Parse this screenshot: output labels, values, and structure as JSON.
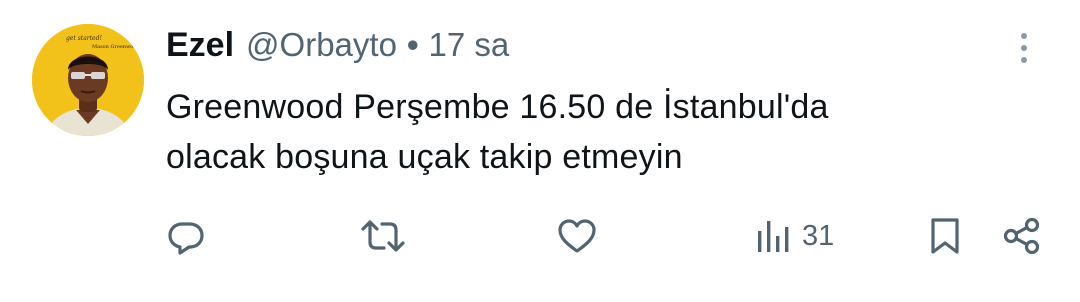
{
  "tweet": {
    "author": {
      "name": "Ezel",
      "handle": "@Orbayto",
      "separator": "•",
      "time": "17 sa",
      "avatar_icon": "avatar-photo",
      "avatar_caption_top": "get started!",
      "avatar_caption_bottom": "Mason Greenwood"
    },
    "text_lines": [
      "Greenwood Perşembe 16.50 de İstanbul'da",
      "olacak boşuna uçak takip etmeyin"
    ],
    "actions": {
      "reply_icon": "reply-icon",
      "retweet_icon": "retweet-icon",
      "like_icon": "heart-icon",
      "views_icon": "views-icon",
      "views_count": "31",
      "bookmark_icon": "bookmark-icon",
      "share_icon": "share-icon"
    },
    "more_icon": "more-vertical-icon",
    "colors": {
      "text": "#0f1419",
      "secondary": "#536471",
      "avatar_bg": "#f5c518"
    }
  }
}
